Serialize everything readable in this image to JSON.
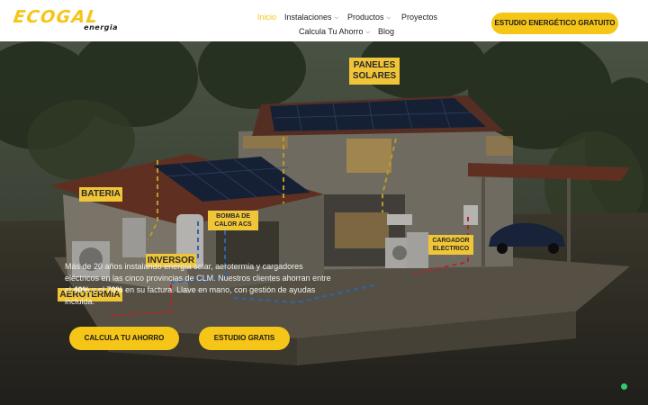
{
  "brand": {
    "logo_main": "ECOGAL",
    "logo_sub": "energia",
    "accent": "#f5c518"
  },
  "nav": {
    "items": [
      {
        "label": "Inicio",
        "active": true
      },
      {
        "label": "Instalaciones",
        "dropdown": true
      },
      {
        "label": "Productos",
        "dropdown": true
      },
      {
        "label": "Proyectos"
      },
      {
        "label": "Calcula Tu Ahorro",
        "dropdown": true
      },
      {
        "label": "Blog"
      }
    ],
    "chevron_icon": "chevron-down-icon"
  },
  "header_cta": "ESTUDIO ENERGÉTICO GRATUITO",
  "hero": {
    "image_labels": {
      "paneles": [
        "PANELES",
        "SOLARES"
      ],
      "bateria": "BATERIA",
      "bomba": [
        "BOMBA DE",
        "CALOR ACS"
      ],
      "inversor": "INVERSOR",
      "cargador": [
        "CARGADOR",
        "ELECTRICO"
      ],
      "aerotermia": "AEROTERMIA"
    },
    "text_part1": "Más de 20 años instalando energía solar, aerotermia y cargadores eléctricos en las cinco provincias de CLM. Nuestros clientes ahorran entre el ",
    "text_bold1": "40%",
    "text_part2": " y el ",
    "text_bold2": "70%",
    "text_part3": " en su factura. Llave en mano, con gestión de ayudas incluida.",
    "btn_calcula": "CALCULA TU AHORRO",
    "btn_estudio": "ESTUDIO GRATIS"
  },
  "status_color": "#2ecc71"
}
